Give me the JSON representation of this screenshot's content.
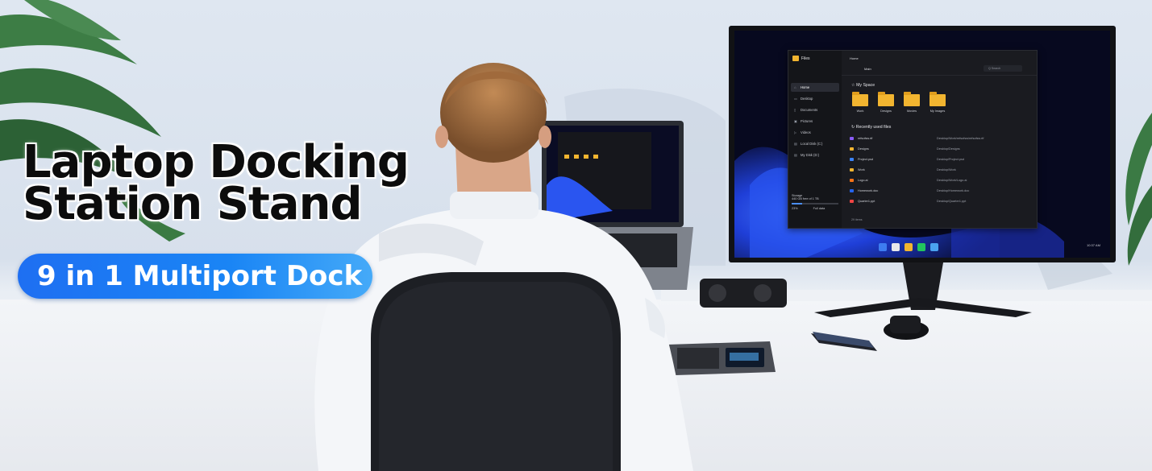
{
  "headline": {
    "line1": "Laptop Docking",
    "line2": "Station Stand"
  },
  "badge": {
    "label": "9 in 1 Multiport Dock"
  },
  "monitor_screen": {
    "app_title": "Files",
    "tab_label": "Home",
    "breadcrumb": "Main",
    "search_placeholder": "Q Search",
    "sidebar_items": [
      "Home",
      "Desktop",
      "Documents",
      "Pictures",
      "Videos",
      "Local Disk (C:)",
      "My Disk (D:)"
    ],
    "storage": {
      "label": "Storage",
      "detail": "440 GB free of 1 TB",
      "percent_label": "23%",
      "action": "Full data"
    },
    "my_space_title": "My Space",
    "folders": [
      "Work",
      "Designs",
      "Movies",
      "My Images"
    ],
    "recent_title": "Recently used files",
    "recent_files": [
      {
        "name": "refsofsw.rtf",
        "path": "Desktop/Work/refsofsw/refsofsw.rtf",
        "color": "#8b5cf6"
      },
      {
        "name": "Designs",
        "path": "Desktop/Designs",
        "color": "#f2b530"
      },
      {
        "name": "Project.psd",
        "path": "Desktop/Project.psd",
        "color": "#3b82f6"
      },
      {
        "name": "Work",
        "path": "Desktop/Work",
        "color": "#f2b530"
      },
      {
        "name": "Logo.ai",
        "path": "Desktop/Work/Logo.ai",
        "color": "#f97316"
      },
      {
        "name": "Homework.doc",
        "path": "Desktop/Homework.doc",
        "color": "#2563eb"
      },
      {
        "name": "Quarter1.ppt",
        "path": "Desktop/Quarter1.ppt",
        "color": "#ef4444"
      }
    ],
    "items_count": "29 items",
    "clock": "10:37 AM"
  },
  "colors": {
    "badge_start": "#1e6ff2",
    "badge_end": "#45aaf8",
    "folder": "#f2b530",
    "headline": "#0c0c0c"
  }
}
